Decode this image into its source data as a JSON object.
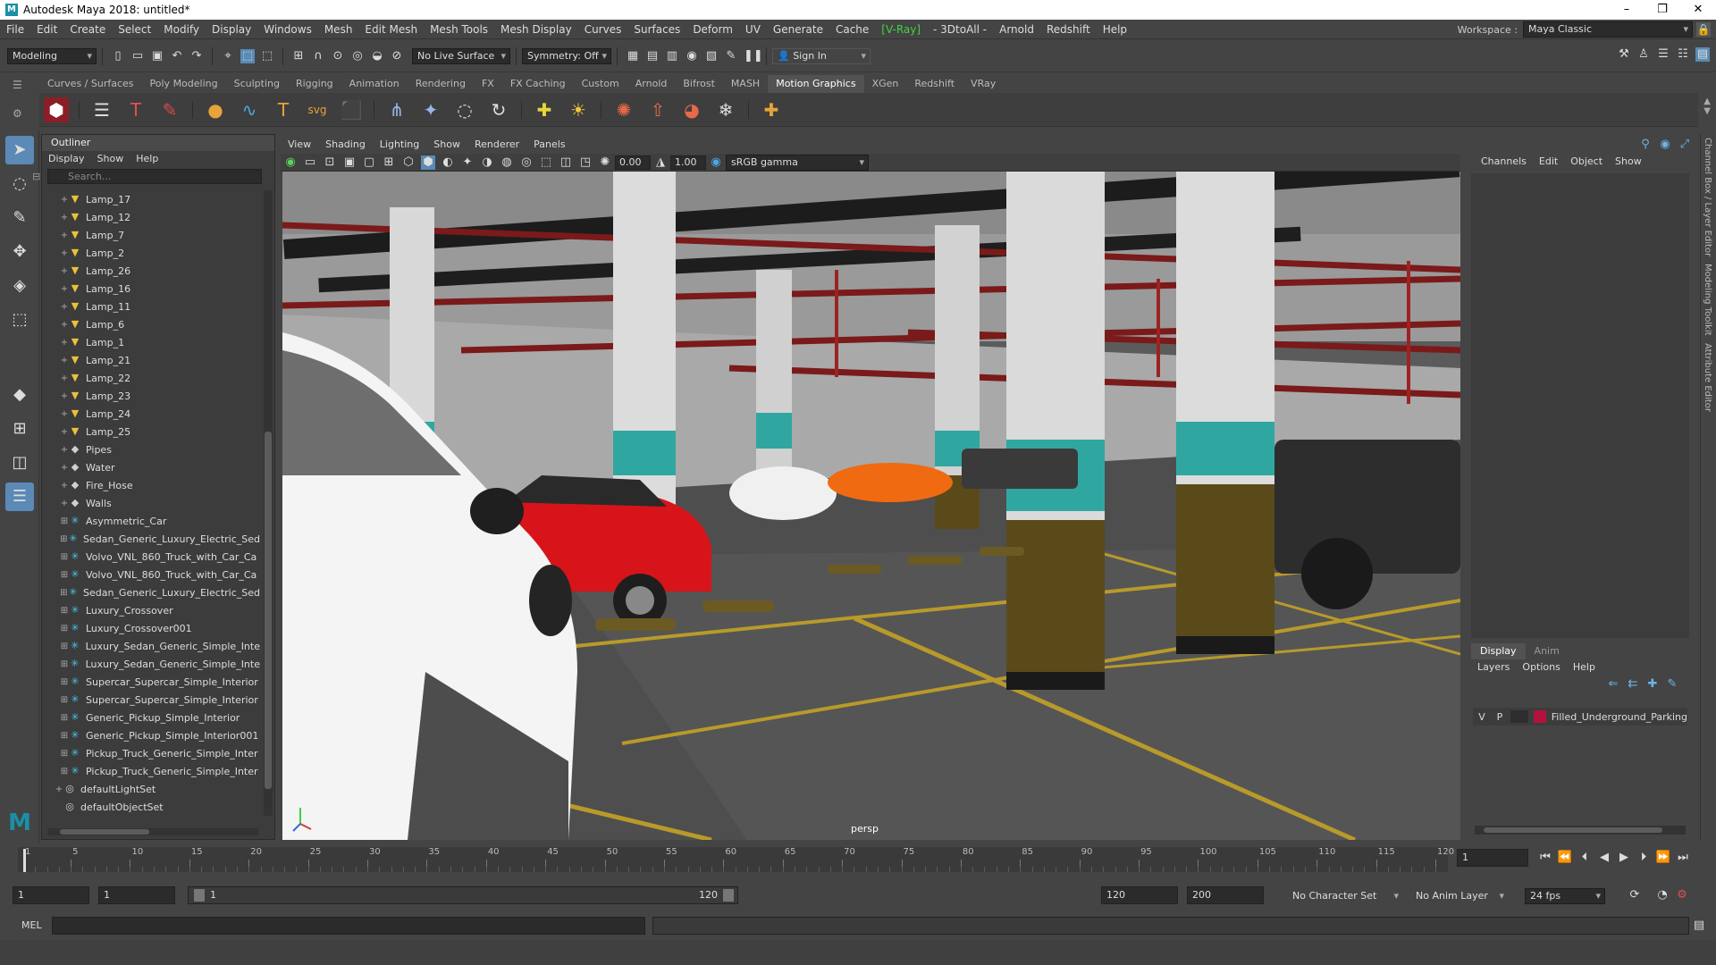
{
  "window": {
    "title": "Autodesk Maya 2018: untitled*",
    "logo": "M"
  },
  "menubar": {
    "items": [
      "File",
      "Edit",
      "Create",
      "Select",
      "Modify",
      "Display",
      "Windows",
      "Mesh",
      "Edit Mesh",
      "Mesh Tools",
      "Mesh Display",
      "Curves",
      "Surfaces",
      "Deform",
      "UV",
      "Generate",
      "Cache"
    ],
    "vray": "[V-Ray]",
    "extra": [
      "- 3DtoAll -",
      "Arnold",
      "Redshift",
      "Help"
    ],
    "workspace_label": "Workspace :",
    "workspace_value": "Maya Classic"
  },
  "statusline": {
    "mode": "Modeling",
    "live_surface": "No Live Surface",
    "symmetry": "Symmetry: Off",
    "sign_in": "Sign In"
  },
  "shelf": {
    "tabs": [
      "Curves / Surfaces",
      "Poly Modeling",
      "Sculpting",
      "Rigging",
      "Animation",
      "Rendering",
      "FX",
      "FX Caching",
      "Custom",
      "Arnold",
      "Bifrost",
      "MASH",
      "Motion Graphics",
      "XGen",
      "Redshift",
      "VRay"
    ],
    "active_tab": "Motion Graphics"
  },
  "outliner": {
    "title": "Outliner",
    "menu": [
      "Display",
      "Show",
      "Help"
    ],
    "search_placeholder": "Search...",
    "items": [
      {
        "label": "Lamp_17",
        "type": "lamp"
      },
      {
        "label": "Lamp_12",
        "type": "lamp"
      },
      {
        "label": "Lamp_7",
        "type": "lamp"
      },
      {
        "label": "Lamp_2",
        "type": "lamp"
      },
      {
        "label": "Lamp_26",
        "type": "lamp"
      },
      {
        "label": "Lamp_16",
        "type": "lamp"
      },
      {
        "label": "Lamp_11",
        "type": "lamp"
      },
      {
        "label": "Lamp_6",
        "type": "lamp"
      },
      {
        "label": "Lamp_1",
        "type": "lamp"
      },
      {
        "label": "Lamp_21",
        "type": "lamp"
      },
      {
        "label": "Lamp_22",
        "type": "lamp"
      },
      {
        "label": "Lamp_23",
        "type": "lamp"
      },
      {
        "label": "Lamp_24",
        "type": "lamp"
      },
      {
        "label": "Lamp_25",
        "type": "lamp"
      },
      {
        "label": "Pipes",
        "type": "group"
      },
      {
        "label": "Water",
        "type": "group"
      },
      {
        "label": "Fire_Hose",
        "type": "group"
      },
      {
        "label": "Walls",
        "type": "group"
      },
      {
        "label": "Asymmetric_Car",
        "type": "joint"
      },
      {
        "label": "Sedan_Generic_Luxury_Electric_Sed",
        "type": "joint"
      },
      {
        "label": "Volvo_VNL_860_Truck_with_Car_Ca",
        "type": "joint"
      },
      {
        "label": "Volvo_VNL_860_Truck_with_Car_Ca",
        "type": "joint"
      },
      {
        "label": "Sedan_Generic_Luxury_Electric_Sed",
        "type": "joint"
      },
      {
        "label": "Luxury_Crossover",
        "type": "joint"
      },
      {
        "label": "Luxury_Crossover001",
        "type": "joint"
      },
      {
        "label": "Luxury_Sedan_Generic_Simple_Inte",
        "type": "joint"
      },
      {
        "label": "Luxury_Sedan_Generic_Simple_Inte",
        "type": "joint"
      },
      {
        "label": "Supercar_Supercar_Simple_Interior",
        "type": "joint"
      },
      {
        "label": "Supercar_Supercar_Simple_Interior",
        "type": "joint"
      },
      {
        "label": "Generic_Pickup_Simple_Interior",
        "type": "joint"
      },
      {
        "label": "Generic_Pickup_Simple_Interior001",
        "type": "joint"
      },
      {
        "label": "Pickup_Truck_Generic_Simple_Inter",
        "type": "joint"
      },
      {
        "label": "Pickup_Truck_Generic_Simple_Inter",
        "type": "joint"
      },
      {
        "label": "defaultLightSet",
        "type": "set"
      },
      {
        "label": "defaultObjectSet",
        "type": "set"
      }
    ]
  },
  "viewport": {
    "menu": [
      "View",
      "Shading",
      "Lighting",
      "Show",
      "Renderer",
      "Panels"
    ],
    "exposure": "0.00",
    "gamma": "1.00",
    "color_space": "sRGB gamma",
    "camera": "persp"
  },
  "channelbox": {
    "menu": [
      "Channels",
      "Edit",
      "Object",
      "Show"
    ],
    "side_tabs": [
      "Channel Box / Layer Editor",
      "Modeling Toolkit",
      "Attribute Editor"
    ]
  },
  "layers": {
    "tabs": [
      "Display",
      "Anim"
    ],
    "menu": [
      "Layers",
      "Options",
      "Help"
    ],
    "row": {
      "v": "V",
      "p": "P",
      "name": "Filled_Underground_Parking",
      "color": "#b3123b"
    }
  },
  "timeline": {
    "ticks": [
      "1",
      "5",
      "10",
      "15",
      "20",
      "25",
      "30",
      "35",
      "40",
      "45",
      "50",
      "55",
      "60",
      "65",
      "70",
      "75",
      "80",
      "85",
      "90",
      "95",
      "100",
      "105",
      "110",
      "115",
      "120"
    ],
    "current_frame": "1"
  },
  "range": {
    "start": "1",
    "start2": "1",
    "slider_start": "1",
    "slider_end": "120",
    "end": "120",
    "end2": "200",
    "character_set": "No Character Set",
    "anim_layer": "No Anim Layer",
    "fps": "24 fps"
  },
  "cmdline": {
    "label": "MEL"
  }
}
